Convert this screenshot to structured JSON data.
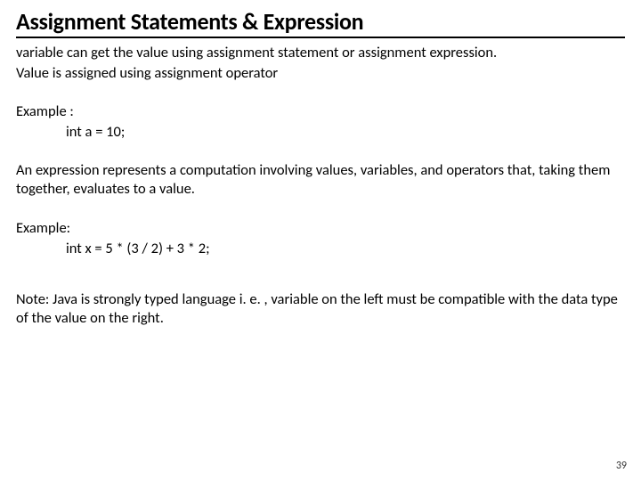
{
  "title": "Assignment Statements & Expression",
  "intro1": "variable can get the value using assignment statement or assignment expression.",
  "intro2": "Value is assigned using assignment operator",
  "example1_label": "Example :",
  "example1_code": "int a = 10;",
  "expr_desc": "An expression represents a computation involving values, variables, and operators that, taking them together, evaluates to a value.",
  "example2_label": "Example:",
  "example2_code": "int x = 5 * (3 / 2) + 3 * 2;",
  "note": "Note: Java is strongly typed language i. e. , variable on the left must be compatible with the data type of the value on the right.",
  "page_number": "39"
}
